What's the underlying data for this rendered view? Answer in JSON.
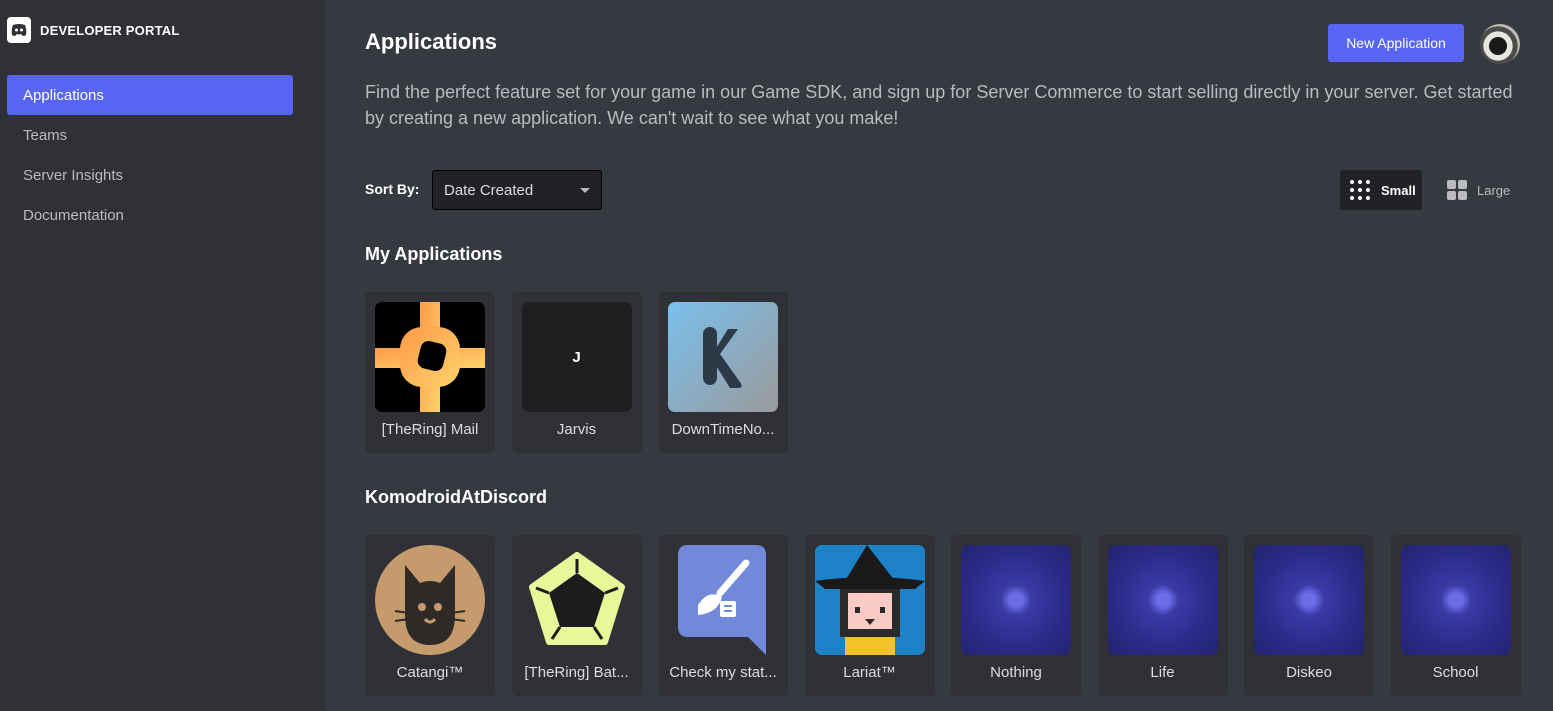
{
  "brand": {
    "title": "DEVELOPER PORTAL",
    "logo_icon": "discord-logo-icon"
  },
  "sidebar": {
    "items": [
      {
        "label": "Applications",
        "active": true
      },
      {
        "label": "Teams",
        "active": false
      },
      {
        "label": "Server Insights",
        "active": false
      },
      {
        "label": "Documentation",
        "active": false
      }
    ]
  },
  "header": {
    "title": "Applications",
    "new_button": "New Application",
    "description": "Find the perfect feature set for your game in our Game SDK, and sign up for Server Commerce to start selling directly in your server. Get started by creating a new application. We can't wait to see what you make!"
  },
  "sort": {
    "label": "Sort By:",
    "value": "Date Created"
  },
  "view": {
    "small_label": "Small",
    "large_label": "Large",
    "selected": "Small"
  },
  "sections": [
    {
      "title": "My Applications",
      "apps": [
        {
          "name": "[TheRing] Mail",
          "icon": "thering-mail-icon"
        },
        {
          "name": "Jarvis",
          "icon": "letter-j-icon",
          "initial": "J"
        },
        {
          "name": "DownTimeNo...",
          "icon": "k-logo-icon"
        }
      ]
    },
    {
      "title": "KomodroidAtDiscord",
      "apps": [
        {
          "name": "Catangi™",
          "icon": "cat-face-icon"
        },
        {
          "name": "[TheRing] Bat...",
          "icon": "pentagon-icon"
        },
        {
          "name": "Check my stat...",
          "icon": "chat-brush-icon"
        },
        {
          "name": "Lariat™",
          "icon": "witch-girl-icon"
        },
        {
          "name": "Nothing",
          "icon": "blurred-logo-icon"
        },
        {
          "name": "Life",
          "icon": "blurred-logo-icon"
        },
        {
          "name": "Diskeo",
          "icon": "blurred-logo-icon"
        },
        {
          "name": "School",
          "icon": "blurred-logo-icon"
        }
      ]
    }
  ],
  "colors": {
    "accent": "#5865f2",
    "sidebar": "#2f3136",
    "background": "#36393f"
  }
}
